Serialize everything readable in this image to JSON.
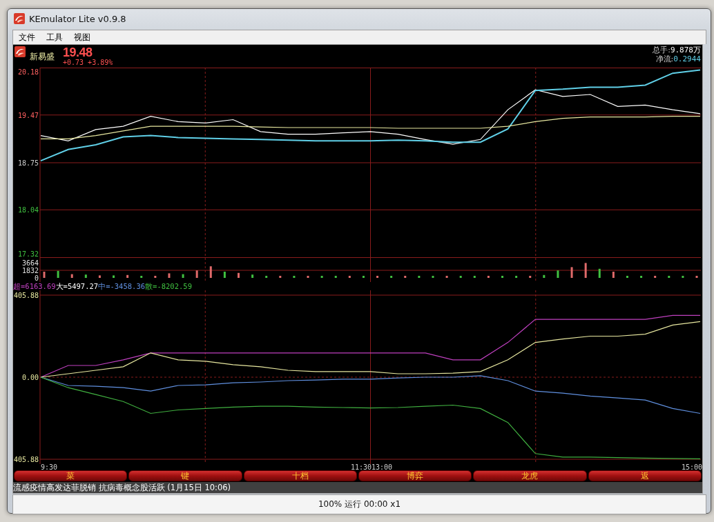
{
  "window": {
    "title": "KEmulator Lite v0.9.8"
  },
  "menu": [
    "文件",
    "工具",
    "视图"
  ],
  "quote": {
    "name": "新易盛",
    "price": "19.48",
    "change": "+0.73 +3.89%"
  },
  "stats": [
    {
      "label": "总手:",
      "value": "9.878万"
    },
    {
      "label": "净流:",
      "value": "0.2944"
    }
  ],
  "price_chart": {
    "chart_data": {
      "type": "line",
      "grid": true,
      "ylim": [
        17.32,
        20.18
      ],
      "yticks": [
        {
          "value": 20.18,
          "label": "20.18"
        },
        {
          "value": 19.47,
          "label": "19.47"
        },
        {
          "value": 18.75,
          "label": "18.75"
        },
        {
          "value": 18.04,
          "label": "18.04"
        },
        {
          "value": 17.32,
          "label": "17.32"
        }
      ],
      "series": [
        {
          "color": "#ffffff",
          "values": [
            19.16,
            19.08,
            19.25,
            19.3,
            19.45,
            19.37,
            19.35,
            19.4,
            19.22,
            19.18,
            19.18,
            19.2,
            19.22,
            19.18,
            19.1,
            19.03,
            19.1,
            19.55,
            19.85,
            19.75,
            19.78,
            19.6,
            19.62,
            19.55,
            19.49
          ]
        },
        {
          "color": "#60d0e8",
          "values": [
            18.78,
            18.95,
            19.02,
            19.14,
            19.16,
            19.13,
            19.12,
            19.11,
            19.1,
            19.09,
            19.08,
            19.08,
            19.08,
            19.09,
            19.08,
            19.06,
            19.06,
            19.26,
            19.84,
            19.86,
            19.89,
            19.89,
            19.92,
            20.1,
            20.15
          ]
        },
        {
          "color": "#e8e8a0",
          "values": [
            19.11,
            19.11,
            19.16,
            19.23,
            19.3,
            19.3,
            19.3,
            19.3,
            19.29,
            19.28,
            19.28,
            19.28,
            19.28,
            19.27,
            19.27,
            19.27,
            19.27,
            19.3,
            19.37,
            19.42,
            19.44,
            19.44,
            19.44,
            19.45,
            19.45
          ]
        }
      ]
    }
  },
  "volume_chart": {
    "chart_data": {
      "type": "bar",
      "stacked": true,
      "ylim": [
        0,
        3664
      ],
      "yticks": [
        {
          "value": 3664,
          "label": "3664"
        },
        {
          "value": 1832,
          "label": "1832"
        },
        {
          "value": 0,
          "label": "0"
        }
      ],
      "series": [
        {
          "color": "#e06a6a",
          "values": [
            1500,
            null,
            900,
            null,
            600,
            null,
            700,
            null,
            500,
            1100,
            null,
            1800,
            2800,
            null,
            1200,
            null,
            null,
            500,
            null,
            500,
            null,
            null,
            500,
            null,
            500,
            null,
            500,
            null,
            null,
            500,
            null,
            null,
            500,
            null,
            null,
            500,
            null,
            null,
            2600,
            3600,
            null,
            1500,
            null,
            null,
            500,
            null,
            null,
            500
          ]
        },
        {
          "color": "#40c040",
          "values": [
            null,
            1700,
            null,
            800,
            null,
            600,
            null,
            500,
            null,
            null,
            900,
            null,
            null,
            1500,
            null,
            800,
            500,
            null,
            500,
            null,
            500,
            500,
            null,
            500,
            null,
            500,
            null,
            500,
            500,
            null,
            500,
            500,
            null,
            500,
            500,
            null,
            700,
            1800,
            null,
            null,
            2200,
            null,
            500,
            500,
            null,
            500,
            500,
            null
          ]
        }
      ]
    }
  },
  "legend": [
    {
      "text": "超=6163.69",
      "color": "#c040c0"
    },
    {
      "text": "大=5497.27",
      "color": "#ffffff"
    },
    {
      "text": "中=-3458.36",
      "color": "#6090e0"
    },
    {
      "text": "散=-8202.59",
      "color": "#40c040"
    }
  ],
  "flow_chart": {
    "chart_data": {
      "type": "line",
      "grid": true,
      "ylim": [
        -405.88,
        405.88
      ],
      "yticks": [
        {
          "value": 405.88,
          "label": "405.88"
        },
        {
          "value": 0,
          "label": "0.00"
        },
        {
          "value": -405.88,
          "label": "405.88"
        }
      ],
      "series": [
        {
          "color": "#c040c0",
          "values": [
            0,
            58,
            58,
            86,
            120,
            120,
            120,
            120,
            120,
            120,
            120,
            120,
            120,
            120,
            120,
            86,
            86,
            172,
            286,
            286,
            286,
            286,
            286,
            306,
            306
          ]
        },
        {
          "color": "#e8e8a0",
          "values": [
            0,
            17,
            34,
            52,
            120,
            86,
            79,
            62,
            52,
            34,
            28,
            28,
            28,
            17,
            17,
            20,
            28,
            86,
            172,
            189,
            203,
            203,
            213,
            258,
            275
          ]
        },
        {
          "color": "#6090e0",
          "values": [
            0,
            -41,
            -45,
            -52,
            -69,
            -41,
            -38,
            -28,
            -24,
            -17,
            -14,
            -10,
            -10,
            -4,
            0,
            0,
            7,
            -17,
            -69,
            -79,
            -93,
            -103,
            -113,
            -155,
            -179
          ]
        },
        {
          "color": "#40b040",
          "values": [
            0,
            -52,
            -86,
            -120,
            -179,
            -162,
            -155,
            -148,
            -144,
            -144,
            -148,
            -150,
            -152,
            -150,
            -144,
            -138,
            -155,
            -224,
            -378,
            -395,
            -395,
            -398,
            -400,
            -402,
            -404
          ]
        }
      ]
    }
  },
  "time_axis": [
    "9:30",
    "11:30",
    "13:00",
    "15:00"
  ],
  "buttons": [
    "菜",
    "键",
    "十档",
    "博弈",
    "龙虎",
    "返"
  ],
  "news": "流感疫情高发达菲脱销 抗病毒概念股活跃 (1月15日 10:06)",
  "status_bar": "100% 运行 00:00 x1"
}
